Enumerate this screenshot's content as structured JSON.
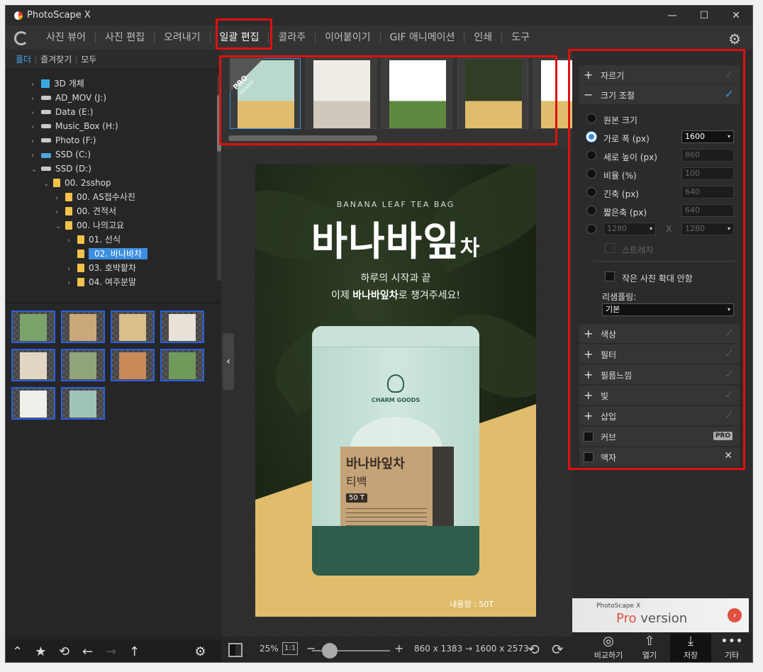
{
  "window": {
    "title": "PhotoScape X",
    "minimize": "—",
    "maximize": "☐",
    "close": "✕"
  },
  "menu": {
    "tabs": [
      "사진 뷰어",
      "사진 편집",
      "오려내기",
      "일괄 편집",
      "콜라주",
      "이어붙이기",
      "GIF 애니메이션",
      "인쇄",
      "도구"
    ],
    "active_tab": "일괄 편집"
  },
  "left": {
    "tabs": [
      "폴더",
      "즐겨찾기",
      "모두"
    ],
    "tree": [
      {
        "label": "3D 개체",
        "icon": "cube",
        "indent": 0,
        "arrow": "›"
      },
      {
        "label": "AD_MOV (J:)",
        "icon": "drive",
        "indent": 0,
        "arrow": "›"
      },
      {
        "label": "Data (E:)",
        "icon": "drive",
        "indent": 0,
        "arrow": "›"
      },
      {
        "label": "Music_Box (H:)",
        "icon": "drive",
        "indent": 0,
        "arrow": "›"
      },
      {
        "label": "Photo (F:)",
        "icon": "drive",
        "indent": 0,
        "arrow": "›"
      },
      {
        "label": "SSD (C:)",
        "icon": "ssd",
        "indent": 0,
        "arrow": "›"
      },
      {
        "label": "SSD (D:)",
        "icon": "drive",
        "indent": 0,
        "arrow": "⌄"
      },
      {
        "label": "00. 2sshop",
        "icon": "folder",
        "indent": 1,
        "arrow": "⌄"
      },
      {
        "label": "00. AS접수사진",
        "icon": "folder",
        "indent": 2,
        "arrow": "›"
      },
      {
        "label": "00. 견적서",
        "icon": "folder",
        "indent": 2,
        "arrow": "›"
      },
      {
        "label": "00. 나의고요",
        "icon": "folder",
        "indent": 2,
        "arrow": "⌄"
      },
      {
        "label": "01. 선식",
        "icon": "folder",
        "indent": 3,
        "arrow": "›"
      },
      {
        "label": "02. 바나바차",
        "icon": "folder",
        "indent": 3,
        "arrow": "",
        "selected": true
      },
      {
        "label": "03. 호박팥차",
        "icon": "folder",
        "indent": 3,
        "arrow": "›"
      },
      {
        "label": "04. 여주분말",
        "icon": "folder",
        "indent": 3,
        "arrow": "›"
      }
    ],
    "thumb_colors": [
      "#7aa36a",
      "#c9a97a",
      "#d9c08a",
      "#e8e2d6",
      "#e2d7c4",
      "#8fa47b",
      "#c98a5a",
      "#6f9a5c",
      "#f0efe9",
      "#9fc4b5"
    ],
    "bottom_icons": [
      "⌃",
      "★",
      "⟲",
      "←",
      "→",
      "↑",
      "⚙"
    ]
  },
  "strip": {
    "pro_badge": "PRO",
    "pro_sub": "Version",
    "thumbs": [
      {
        "bg": "#b9d9cd",
        "accent": "#e0bd6c",
        "selected": true
      },
      {
        "bg": "#f0ece6",
        "accent": "#d0c8bc",
        "selected": false
      },
      {
        "bg": "#ffffff",
        "accent": "#5d8a3e",
        "selected": false
      },
      {
        "bg": "#2f3e25",
        "accent": "#e0bd6c",
        "selected": false
      },
      {
        "bg": "#ffffff",
        "accent": "#e0bd6c",
        "selected": false
      }
    ]
  },
  "poster": {
    "subtitle": "BANANA LEAF TEA BAG",
    "title_main": "바나바잎",
    "title_small": "차",
    "line1": "하루의 시작과 끝",
    "line2_pre": "이제 ",
    "line2_bold": "바나바잎차",
    "line2_post": "로 챙겨주세요!",
    "pouch_brand": "CHARM GOODS",
    "pouch_title": "바나바잎차",
    "pouch_sub": "티백",
    "pouch_count": "50 T",
    "content": "내용량 : 50T"
  },
  "center_bottom": {
    "zoom": "25%",
    "one_to_one": "1:1",
    "minus": "−",
    "plus": "+",
    "size_info": "860 x 1383 → 1600 x 2573",
    "rotate_left": "⟲",
    "rotate_right": "⟳",
    "collapse": "‹"
  },
  "right": {
    "crop": "자르기",
    "resize": "크기 조절",
    "options": [
      {
        "label": "원본 크기",
        "value": "",
        "on": false,
        "dim": false
      },
      {
        "label": "가로 폭 (px)",
        "value": "1600",
        "on": true,
        "dim": false
      },
      {
        "label": "세로 높이 (px)",
        "value": "860",
        "on": false,
        "dim": true
      },
      {
        "label": "비율 (%)",
        "value": "100",
        "on": false,
        "dim": true
      },
      {
        "label": "긴축 (px)",
        "value": "640",
        "on": false,
        "dim": true
      },
      {
        "label": "짧은축 (px)",
        "value": "640",
        "on": false,
        "dim": true
      }
    ],
    "custom_w": "1280",
    "custom_h": "1280",
    "custom_x": "X",
    "stretch": "스트레치",
    "no_enlarge": "작은 사진 확대 안함",
    "resample_label": "리샘플링:",
    "resample_value": "기본",
    "collapsed_sections": [
      "색상",
      "필터",
      "필름느낌",
      "빛",
      "삽입"
    ],
    "curves": "커브",
    "curves_badge": "PRO",
    "frame": "액자",
    "pro_banner_top": "PhotoScape X",
    "pro_banner_pro": "Pro",
    "pro_banner_version": " version",
    "bottom": [
      {
        "icon": "◎",
        "label": "비교하기"
      },
      {
        "icon": "⇧",
        "label": "열기"
      },
      {
        "icon": "⤓",
        "label": "저장"
      },
      {
        "icon": "•••",
        "label": "기타"
      }
    ]
  }
}
